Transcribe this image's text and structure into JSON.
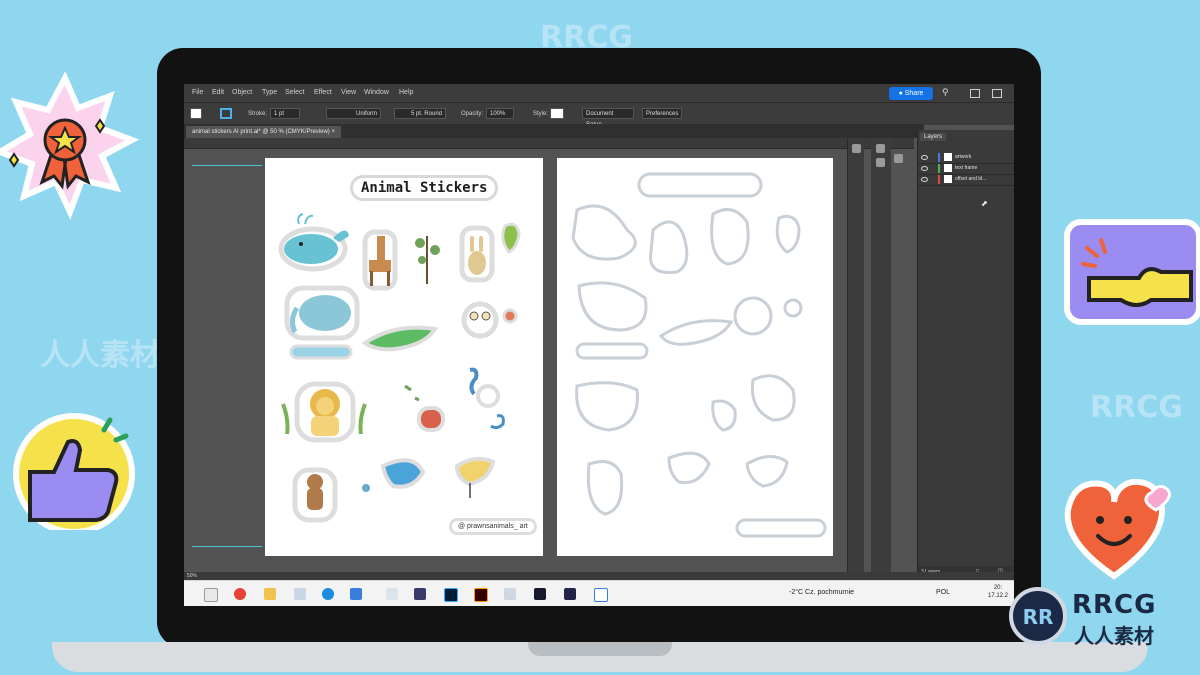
{
  "menubar": {
    "items": [
      "File",
      "Edit",
      "Object",
      "Type",
      "Select",
      "Effect",
      "View",
      "Window",
      "Help"
    ],
    "share_label": "Share"
  },
  "controlbar": {
    "stroke_label": "Stroke:",
    "stroke_value": "1 pt",
    "stroke_style": "Uniform",
    "brush": "5 pt. Round",
    "opacity_label": "Opacity:",
    "opacity_value": "100%",
    "style_label": "Style:",
    "document_setup": "Document Setup",
    "preferences": "Preferences"
  },
  "document": {
    "tab_title": "animal stickers AI print.ai* @ 50 % (CMYK/Preview)",
    "sheet_title": "Animal Stickers",
    "credit": "@ prawnsanimals_ art"
  },
  "layers": {
    "tab_label": "Layers",
    "rows": [
      {
        "name": "artwork",
        "color": "#4a7bd8"
      },
      {
        "name": "text frame",
        "color": "#52b24a"
      },
      {
        "name": "offset and bl...",
        "color": "#d84a4a"
      }
    ],
    "footer": "3 Layers"
  },
  "statusbar": {
    "zoom": "50%"
  },
  "taskbar": {
    "weather": "-2°C Cz. pochmurnie",
    "language": "POL",
    "time": "20:",
    "date": "17.12.2"
  },
  "brand": {
    "logo_text": "RRCG",
    "logo_subtitle": "人人素材"
  },
  "colors": {
    "background": "#8fd6ef",
    "share_blue": "#1473e6",
    "sticker_purple": "#9a8cf0",
    "sticker_yellow": "#f5e24a",
    "sticker_red": "#f0623a"
  }
}
